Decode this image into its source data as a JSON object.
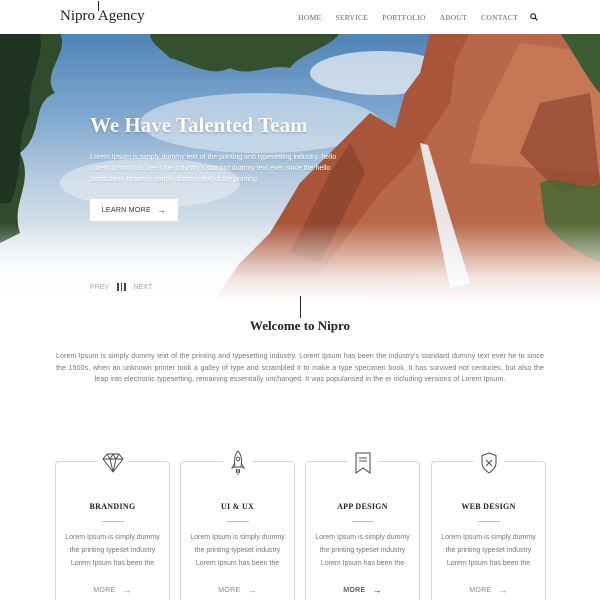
{
  "header": {
    "logo": "Nipro Agency",
    "nav": [
      "HOME",
      "SERVICE",
      "PORTFOLIO",
      "ABOUT",
      "CONTACT"
    ]
  },
  "hero": {
    "title": "We Have Talented Team",
    "text": "Lorem Ipsum is simply dummy text of the printing and typesetting industry. hello Lorem Ipsum has been the industry's stanard dummy text ever since the hello bossLorem Ipsum is simply dummy text of the printing",
    "button_label": "LEARN MORE",
    "prev": "PREV",
    "next": "NEXT"
  },
  "welcome": {
    "title": "Welcome to Nipro",
    "text": "Lorem Ipsum is simply dummy text of the printing and typesetting industry. Lorem Ipsum has been the industry's standard dummy text ever he to since the 1500s, when an unknown printer took a galley of type and scrambled it to make a type specimen book. It has survived not centuries, but also the leap into electronic typesetting, remaining essentially unchanged. It was popularised in the er including versions of Lorem Ipsum."
  },
  "services": [
    {
      "title": "BRANDING",
      "icon": "diamond-icon",
      "text": "Lorem Ipsum is simply dummy the printing typeset industry Lorem Ipsum has been the",
      "more": "MORE"
    },
    {
      "title": "UI & UX",
      "icon": "rocket-icon",
      "text": "Lorem Ipsum is simply dummy the printing typeset industry Lorem Ipsum has been the",
      "more": "MORE"
    },
    {
      "title": "APP DESIGN",
      "icon": "bookmark-icon",
      "text": "Lorem Ipsum is simply dummy the printing typeset industry Lorem Ipsum has been the",
      "more": "MORE"
    },
    {
      "title": "WEB DESIGN",
      "icon": "shield-icon",
      "text": "Lorem Ipsum is simply dummy the printing typeset industry Lorem Ipsum has been the",
      "more": "MORE"
    }
  ]
}
